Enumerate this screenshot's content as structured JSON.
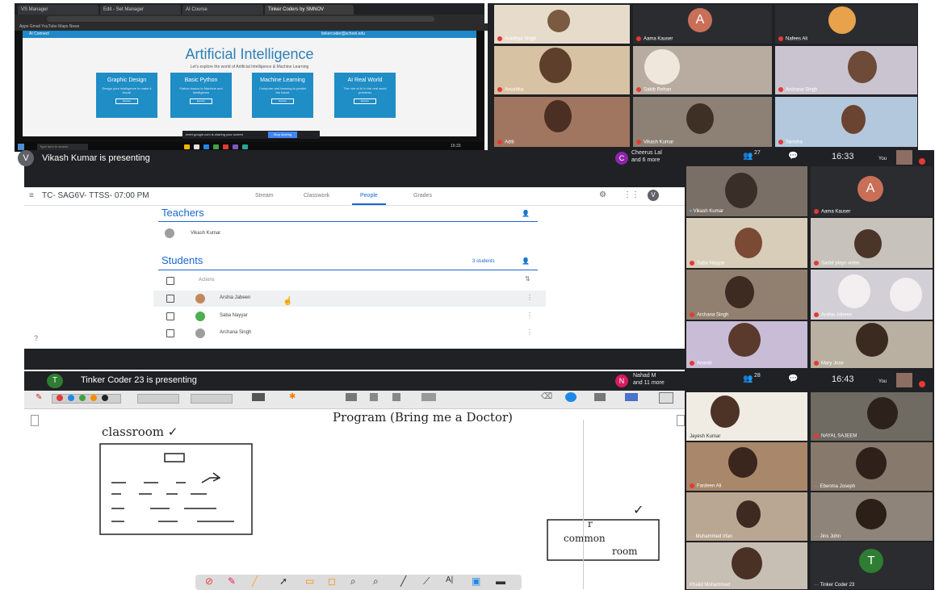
{
  "panel_browser": {
    "tabs": [
      "VS Manager",
      "Edit - Set Manager",
      "AI Course",
      "Tinker Coders by SMNOV"
    ],
    "bookmarks": "Apps  Gmail  YouTube  Maps  News",
    "site_nav": "AI Connect",
    "site_user": "tinkercoder@school.edu",
    "site_title": "Artificial Intelligence",
    "site_subtitle": "Let's explore the world of Artificial Intelligence & Machine Learning",
    "cards": [
      {
        "title": "Graphic Design",
        "desc": "Design your intelligence to make it visual.",
        "btn": "Explore"
      },
      {
        "title": "Basic Python",
        "desc": "Python basics to Machine and Intelligence",
        "btn": "Explore"
      },
      {
        "title": "Machine Learning",
        "desc": "Computer and learning to predict the future",
        "btn": "Explore"
      },
      {
        "title": "AI Real World",
        "desc": "The role of AI in the real world problems",
        "btn": "Explore"
      }
    ],
    "snackbar": "meet.google.com is sharing your screen",
    "snackbar_button": "Stop sharing",
    "search": "Type here to search",
    "clock": "16:33"
  },
  "panel_gallery_top": {
    "tiles": [
      "Aradhya Singh",
      "Aama Kauser",
      "Nafees Ali",
      "Anushka",
      "Sakib Rehan",
      "Archana Singh",
      "Aditi",
      "Vikash Kumar",
      "Tanisha"
    ],
    "avatar_letter": "A"
  },
  "panel_classroom": {
    "presenter_initial": "V",
    "presenter_text": "Vikash Kumar is presenting",
    "class_title": "TC- SAG6V- TTSS- 07:00 PM",
    "tabs": [
      "Stream",
      "Classwork",
      "People",
      "Grades"
    ],
    "teachers_heading": "Teachers",
    "teacher_name": "Vikash Kumar",
    "students_heading": "Students",
    "students_count": "3 students",
    "actions_label": "Actions",
    "students": [
      "Arshia Jabeen",
      "Saba Nayyar",
      "Archana Singh"
    ]
  },
  "panel_gallery_mid": {
    "participants_initial": "C",
    "participants_text": "Cheerus Lal",
    "participants_more": "and 6 more",
    "count": "27",
    "time": "16:33",
    "self_label": "You",
    "tiles": [
      "Vikash Kumar",
      "Aama Kauser",
      "Saba Nayyar",
      "Sadaf plays video",
      "Archana Singh",
      "Arshia Jabeen",
      "Anandi",
      "Mary Jose"
    ],
    "avatar_letter": "A"
  },
  "panel_whiteboard": {
    "presenter_initial": "T",
    "presenter_text": "Tinker Coder 23 is presenting",
    "participants_initial": "N",
    "participants_text": "Nahad M",
    "participants_more": "and 11 more",
    "count": "28",
    "time": "16:43",
    "self_label": "You",
    "note_classroom": "classroom ✓",
    "note_program": "Program (Bring me a Doctor)",
    "note_common_1": "common",
    "note_common_2": "room",
    "note_r": "r",
    "note_check": "✓"
  },
  "panel_gallery_bottom": {
    "tiles": [
      "Jayesh Kumar",
      "NAYAL SAJEEM",
      "Fardeen Ali",
      "Ebenma Joseph",
      "Muhammed Irfan",
      "Jins John",
      "Khalid Mohammed",
      "Tinker Coder 23"
    ],
    "avatar_letter": "T"
  },
  "colors": {
    "meet_dark": "#202124",
    "classroom_blue": "#1967d2",
    "site_blue": "#1f8dc6",
    "avatar_orange": "#e37a5a",
    "avatar_green": "#2e7d32",
    "mic_red": "#e53935"
  }
}
